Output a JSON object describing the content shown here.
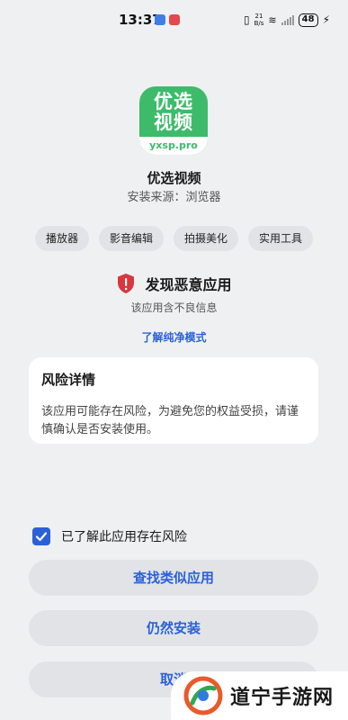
{
  "status_bar": {
    "time": "13:37",
    "net_speed_top": "21",
    "net_speed_bottom": "B/s",
    "battery": "48"
  },
  "app": {
    "icon_text": "优选视频",
    "icon_domain": "yxsp.pro",
    "name": "优选视频",
    "source": "安装来源：浏览器",
    "tags": [
      "播放器",
      "影音编辑",
      "拍摄美化",
      "实用工具"
    ]
  },
  "warning": {
    "title": "发现恶意应用",
    "subtitle": "该应用含不良信息",
    "link": "了解纯净模式"
  },
  "risk_card": {
    "title": "风险详情",
    "body": "该应用可能存在风险，为避免您的权益受损，请谨慎确认是否安装使用。"
  },
  "consent": {
    "label": "已了解此应用存在风险",
    "checked": true
  },
  "buttons": {
    "find_similar": "查找类似应用",
    "install_anyway": "仍然安装",
    "cancel": "取消"
  },
  "watermark": {
    "text": "道宁手游网"
  },
  "colors": {
    "accent": "#2b61d8",
    "danger": "#d9363e",
    "brand_green": "#3dbb6a"
  }
}
